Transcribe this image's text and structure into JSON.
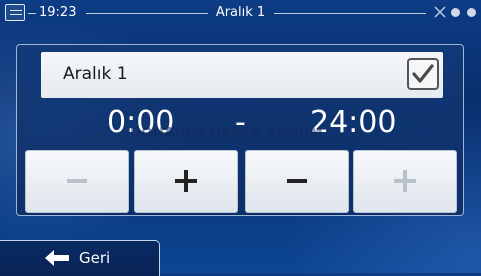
{
  "statusbar": {
    "time": "19:23",
    "title": "Aralık 1",
    "left_icon": "menu-icon",
    "satellite_icon": "satellite-icon"
  },
  "editor": {
    "name": "Aralık 1",
    "checked": true,
    "start_time": "0:00",
    "separator": "-",
    "end_time": "24:00"
  },
  "watermark": "DONANIM HABER FORUM",
  "buttons": {
    "start_minus": {
      "label": "−",
      "enabled": false
    },
    "start_plus": {
      "label": "+",
      "enabled": true
    },
    "end_minus": {
      "label": "−",
      "enabled": true
    },
    "end_plus": {
      "label": "+",
      "enabled": false
    }
  },
  "back": {
    "label": "Geri",
    "icon": "arrow-left-icon"
  },
  "colors": {
    "background": "#0b3a80",
    "panel_border": "#9fb6d8",
    "button_face": "#e8edf2",
    "disabled_glyph": "#b9c1cb"
  }
}
